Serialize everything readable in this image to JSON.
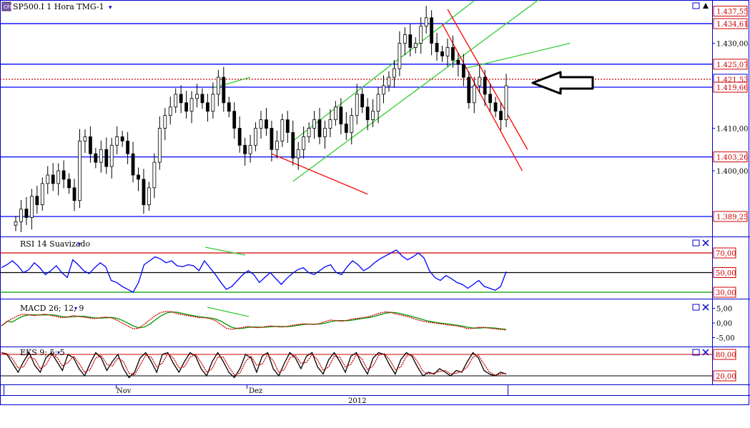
{
  "header": {
    "title": "SP500.I 1 Hora TMG-1",
    "menu_caret": "▾"
  },
  "panels": {
    "rsi_title": "RSI 14 Suavizado",
    "macd_title": "MACD 26; 12; 9",
    "stoch_title": "EKS 9; 5; 5"
  },
  "xaxis": {
    "months": [
      "Nov",
      "Dez"
    ],
    "year": "2012"
  },
  "colors": {
    "frame": "#0000cc",
    "price_line": "#000000",
    "level_line": "#0000ff",
    "resistance_dotted": "#cc0000",
    "up_channel": "#33cc33",
    "down_channel": "#ff0000",
    "rsi_line": "#0000ff",
    "macd": "#cc0000",
    "signal": "#009900",
    "label_text": "#cc0000",
    "last_price_label": "#0000cc"
  },
  "icons": {
    "window": "square-icon",
    "close": "close-icon",
    "up_arrow": "triangle-up-icon",
    "big_arrow": "left-arrow-icon"
  },
  "chart_data": [
    {
      "type": "line",
      "name": "price",
      "ylim": [
        1388,
        1438
      ],
      "yticks": [
        "1.400,00",
        "1.410,00",
        "1.430,00"
      ],
      "price_labels": [
        "1.437,55",
        "1.434,61",
        "1.425,07",
        "1.421,53",
        "1.419,66",
        "1.403,26",
        "1.389,25"
      ],
      "price_label_values": [
        1437.55,
        1434.61,
        1425.07,
        1421.53,
        1419.66,
        1403.26,
        1389.25
      ],
      "horizontal_levels": [
        1434.61,
        1425.07,
        1419.66,
        1403.26,
        1389.25
      ],
      "dotted_level": 1421.53,
      "last_price": "1.421,53",
      "close": [
        1388,
        1391,
        1389,
        1394,
        1392,
        1397,
        1399,
        1397,
        1400,
        1398,
        1396,
        1393,
        1407,
        1408,
        1404,
        1402,
        1405,
        1401,
        1406,
        1408,
        1407,
        1404,
        1399,
        1398,
        1392,
        1396,
        1402,
        1410,
        1413,
        1415,
        1418,
        1416,
        1414,
        1417,
        1418,
        1416,
        1414,
        1418,
        1422,
        1416,
        1414,
        1410,
        1406,
        1404,
        1406,
        1410,
        1412,
        1410,
        1405,
        1407,
        1412,
        1409,
        1403,
        1405,
        1408,
        1410,
        1412,
        1408,
        1410,
        1412,
        1415,
        1411,
        1409,
        1413,
        1418,
        1415,
        1412,
        1414,
        1418,
        1420,
        1422,
        1424,
        1430,
        1432,
        1429,
        1430,
        1434,
        1436,
        1430,
        1428,
        1427,
        1429,
        1426,
        1425,
        1422,
        1416,
        1420,
        1422,
        1418,
        1416,
        1414,
        1412,
        1420
      ]
    },
    {
      "type": "line",
      "name": "RSI",
      "ylim": [
        20,
        80
      ],
      "levels": [
        70,
        50,
        30
      ],
      "ytick_labels": [
        "70,00",
        "50,00",
        "30,00"
      ],
      "values": [
        55,
        58,
        62,
        57,
        50,
        53,
        60,
        55,
        48,
        52,
        57,
        50,
        45,
        63,
        58,
        52,
        49,
        55,
        60,
        56,
        42,
        40,
        36,
        33,
        30,
        40,
        58,
        62,
        66,
        64,
        60,
        62,
        57,
        56,
        58,
        57,
        52,
        62,
        55,
        48,
        40,
        33,
        36,
        42,
        48,
        52,
        48,
        40,
        45,
        50,
        44,
        38,
        44,
        49,
        53,
        55,
        50,
        48,
        52,
        56,
        58,
        50,
        48,
        56,
        62,
        58,
        52,
        55,
        60,
        64,
        67,
        70,
        73,
        67,
        63,
        66,
        70,
        65,
        52,
        45,
        42,
        47,
        44,
        40,
        38,
        34,
        38,
        42,
        36,
        34,
        32,
        36,
        51
      ]
    },
    {
      "type": "line",
      "name": "MACD",
      "ylim": [
        -7,
        7
      ],
      "ytick_labels": [
        "5,00",
        "0,00",
        "-5,00"
      ],
      "ytick_values": [
        5,
        0,
        -5
      ],
      "macd": [
        -1,
        0.5,
        1.5,
        2.5,
        3,
        2.8,
        2.5,
        2.8,
        3,
        2.6,
        2.2,
        1.8,
        2,
        2.5,
        2.3,
        2,
        1.7,
        1.5,
        1.8,
        2,
        1.8,
        1,
        0,
        -1,
        -2,
        -1.8,
        -0.5,
        1,
        2.5,
        3.5,
        4,
        3.8,
        3.2,
        2.8,
        2.5,
        2.2,
        1.8,
        1.8,
        1.5,
        0.8,
        -0.5,
        -1.8,
        -2.2,
        -1.8,
        -1.5,
        -1.2,
        -1.5,
        -1.6,
        -1.3,
        -1,
        -1.2,
        -1.4,
        -1.2,
        -0.8,
        -0.5,
        -0.3,
        -0.4,
        -0.5,
        -0.2,
        0.5,
        1,
        0.8,
        0.6,
        0.9,
        1.4,
        1.6,
        1.8,
        2.2,
        2.8,
        3.4,
        3.8,
        3.6,
        3,
        2.6,
        2.2,
        1.6,
        1,
        0.5,
        0.2,
        0,
        -0.3,
        -0.5,
        -0.8,
        -1,
        -1.4,
        -2,
        -1.8,
        -1.5,
        -1.5,
        -1.8,
        -2,
        -2.2,
        -2.4
      ]
    },
    {
      "type": "line",
      "name": "Stochastic",
      "ylim": [
        0,
        100
      ],
      "levels": [
        80,
        20
      ],
      "ytick_labels": [
        "80,00",
        "20,00"
      ],
      "values": [
        85,
        80,
        55,
        30,
        60,
        85,
        50,
        30,
        70,
        85,
        60,
        35,
        80,
        70,
        40,
        20,
        55,
        85,
        70,
        35,
        60,
        80,
        40,
        15,
        30,
        70,
        85,
        60,
        30,
        80,
        85,
        55,
        30,
        60,
        85,
        75,
        40,
        20,
        60,
        85,
        60,
        30,
        15,
        40,
        80,
        70,
        30,
        75,
        85,
        40,
        20,
        55,
        85,
        70,
        40,
        75,
        85,
        45,
        25,
        65,
        85,
        60,
        30,
        75,
        85,
        50,
        25,
        70,
        85,
        80,
        50,
        25,
        65,
        85,
        75,
        45,
        20,
        30,
        25,
        40,
        30,
        20,
        35,
        30,
        60,
        85,
        70,
        35,
        25,
        20,
        30,
        25
      ]
    }
  ]
}
